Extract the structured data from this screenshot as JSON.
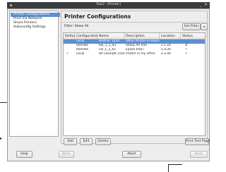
{
  "window": {
    "title": "Yast2 - [Printer]"
  },
  "sidebar": {
    "items": [
      {
        "label": "Printer Configurations",
        "selected": true
      },
      {
        "label": "Print Via Network",
        "selected": false
      },
      {
        "label": "Share Printers",
        "selected": false
      },
      {
        "label": "Autoconfig Settings",
        "selected": false
      }
    ]
  },
  "main": {
    "title": "Printer Configurations",
    "filter_label": "Filter: Show All",
    "set_filter_label": "Set Filter",
    "dropdown_glyph": "▾"
  },
  "table": {
    "columns": [
      "Default",
      "Configuration",
      "Name",
      "Description",
      "Location",
      "Status"
    ],
    "rows": [
      {
        "default": "",
        "configuration": "Local",
        "name": "Brother 1250",
        "description": "Other Printer in Room",
        "location": "",
        "status": "",
        "selected": true
      },
      {
        "default": "",
        "configuration": "Remote",
        "name": "bw_1_1_03",
        "description": "Sharp AR 450",
        "location": "2.1.16",
        "status": "error",
        "selected": false
      },
      {
        "default": "",
        "configuration": "Remote",
        "name": "col_1_3_61",
        "description": "Epson R567",
        "location": "2.4.26",
        "status": "ok",
        "selected": false
      },
      {
        "default": "✔",
        "configuration": "Local",
        "name": "HP LaserJet 2508",
        "description": "Printer in my office",
        "location": "2.2.00",
        "status": "ok",
        "selected": false
      }
    ]
  },
  "buttons": {
    "add": "Add",
    "edit": "Edit",
    "delete": "Delete",
    "print_test_page": "Print Test Page",
    "help": "Help",
    "back": "Back",
    "abort": "Abort",
    "next": "Next"
  },
  "icons": {
    "ok_glyph": "✔",
    "error_glyph": "✘",
    "close_glyph": "×",
    "minimize_glyph": "_"
  },
  "colors": {
    "selection": "#5d8fcf",
    "ok": "#3a9a2a",
    "error": "#d23a1f"
  }
}
